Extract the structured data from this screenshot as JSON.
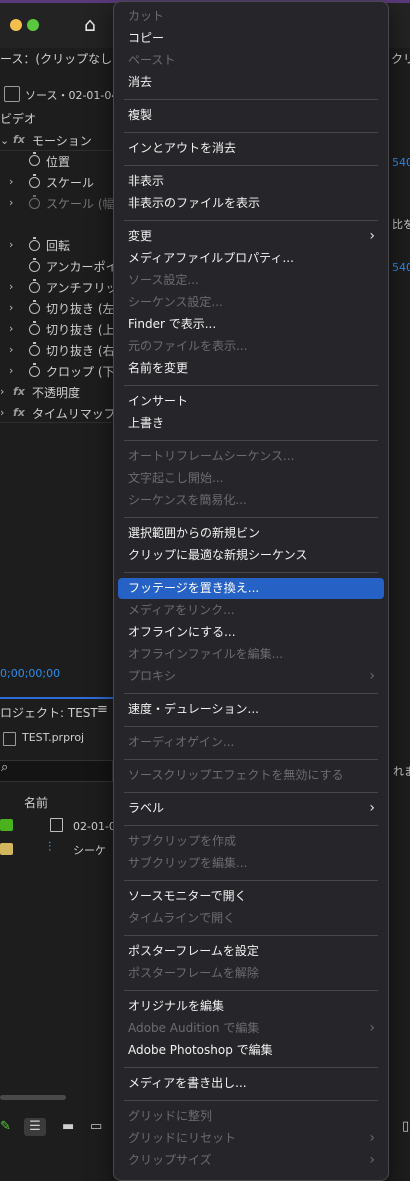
{
  "background_panel": {
    "header_text": "ース：(クリップなし)",
    "right_header_text": "クリ",
    "source_tab": "ソース・02-01-04",
    "video_label": "ビデオ",
    "motion_label": "モーション",
    "properties": [
      "位置",
      "スケール",
      "スケール (幅",
      "回転",
      "アンカーポイ",
      "アンチフリッ",
      "切り抜き (左",
      "切り抜き (上",
      "切り抜き (右",
      "クロップ (下"
    ],
    "opacity_label": "不透明度",
    "timeremap_label": "タイムリマップ",
    "right_values": [
      "540",
      "比を",
      "540"
    ],
    "timecode": "0;00;00;00",
    "project_title": "ロジェクト: TEST",
    "project_file": "TEST.prproj",
    "name_header": "名前",
    "right_small_1": "れま",
    "right_small_2": "",
    "items": [
      "02-01-04",
      "シーケ"
    ],
    "swatch_colors": [
      "#49b21d",
      "#d3b75c"
    ]
  },
  "context_menu": {
    "items": [
      {
        "label": "カット",
        "enabled": false
      },
      {
        "label": "コピー",
        "enabled": true
      },
      {
        "label": "ペースト",
        "enabled": false
      },
      {
        "label": "消去",
        "enabled": true
      },
      {
        "label": "複製",
        "enabled": true
      },
      {
        "label": "インとアウトを消去",
        "enabled": true
      },
      {
        "label": "非表示",
        "enabled": true
      },
      {
        "label": "非表示のファイルを表示",
        "enabled": true
      },
      {
        "label": "変更",
        "enabled": true,
        "submenu": true
      },
      {
        "label": "メディアファイルプロパティ...",
        "enabled": true
      },
      {
        "label": "ソース設定...",
        "enabled": false
      },
      {
        "label": "シーケンス設定...",
        "enabled": false
      },
      {
        "label": "Finder で表示...",
        "enabled": true
      },
      {
        "label": "元のファイルを表示...",
        "enabled": false
      },
      {
        "label": "名前を変更",
        "enabled": true
      },
      {
        "label": "インサート",
        "enabled": true
      },
      {
        "label": "上書き",
        "enabled": true
      },
      {
        "label": "オートリフレームシーケンス...",
        "enabled": false
      },
      {
        "label": "文字起こし開始...",
        "enabled": false
      },
      {
        "label": "シーケンスを簡易化...",
        "enabled": false
      },
      {
        "label": "選択範囲からの新規ビン",
        "enabled": true
      },
      {
        "label": "クリップに最適な新規シーケンス",
        "enabled": true
      },
      {
        "label": "フッテージを置き換え...",
        "enabled": true,
        "selected": true
      },
      {
        "label": "メディアをリンク...",
        "enabled": false
      },
      {
        "label": "オフラインにする...",
        "enabled": true
      },
      {
        "label": "オフラインファイルを編集...",
        "enabled": false
      },
      {
        "label": "プロキシ",
        "enabled": false,
        "submenu": true
      },
      {
        "label": "速度・デュレーション...",
        "enabled": true
      },
      {
        "label": "オーディオゲイン...",
        "enabled": false
      },
      {
        "label": "ソースクリップエフェクトを無効にする",
        "enabled": false
      },
      {
        "label": "ラベル",
        "enabled": true,
        "submenu": true
      },
      {
        "label": "サブクリップを作成",
        "enabled": false
      },
      {
        "label": "サブクリップを編集...",
        "enabled": false
      },
      {
        "label": "ソースモニターで開く",
        "enabled": true
      },
      {
        "label": "タイムラインで開く",
        "enabled": false
      },
      {
        "label": "ポスターフレームを設定",
        "enabled": true
      },
      {
        "label": "ポスターフレームを解除",
        "enabled": false
      },
      {
        "label": "オリジナルを編集",
        "enabled": true
      },
      {
        "label": "Adobe Audition で編集",
        "enabled": false,
        "submenu": true
      },
      {
        "label": "Adobe Photoshop で編集",
        "enabled": true
      },
      {
        "label": "メディアを書き出し...",
        "enabled": true
      },
      {
        "label": "グリッドに整列",
        "enabled": false
      },
      {
        "label": "グリッドにリセット",
        "enabled": false,
        "submenu": true
      },
      {
        "label": "クリップサイズ",
        "enabled": false,
        "submenu": true
      }
    ],
    "submenu_glyph": "›"
  }
}
